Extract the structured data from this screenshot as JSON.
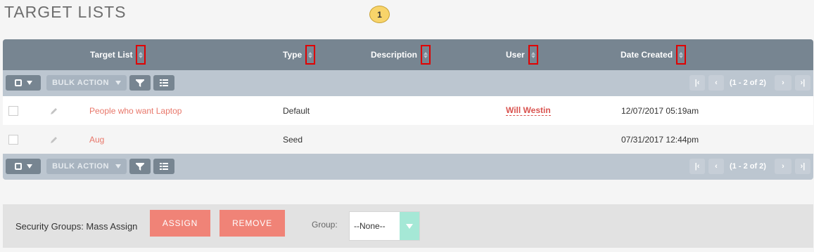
{
  "page": {
    "title": "TARGET LISTS",
    "callout_number": "1"
  },
  "columns": [
    {
      "label": "Target List"
    },
    {
      "label": "Type"
    },
    {
      "label": "Description"
    },
    {
      "label": "User"
    },
    {
      "label": "Date Created"
    }
  ],
  "toolbar": {
    "bulk_action_label": "BULK ACTION",
    "pagination_text": "(1 - 2 of 2)"
  },
  "rows": [
    {
      "name": "People who want Laptop",
      "type": "Default",
      "description": "",
      "user": "Will Westin",
      "date_created": "12/07/2017 05:19am"
    },
    {
      "name": "Aug",
      "type": "Seed",
      "description": "",
      "user": "",
      "date_created": "07/31/2017 12:44pm"
    }
  ],
  "mass_assign": {
    "label": "Security Groups: Mass Assign",
    "assign_label": "ASSIGN",
    "remove_label": "REMOVE",
    "group_label": "Group:",
    "group_selected": "--None--"
  },
  "colors": {
    "header_bg": "#778591",
    "toolbar_bg": "#bcc6d0",
    "link_color": "#e8776a",
    "button_color": "#f08377",
    "sort_highlight": "#e00000"
  }
}
